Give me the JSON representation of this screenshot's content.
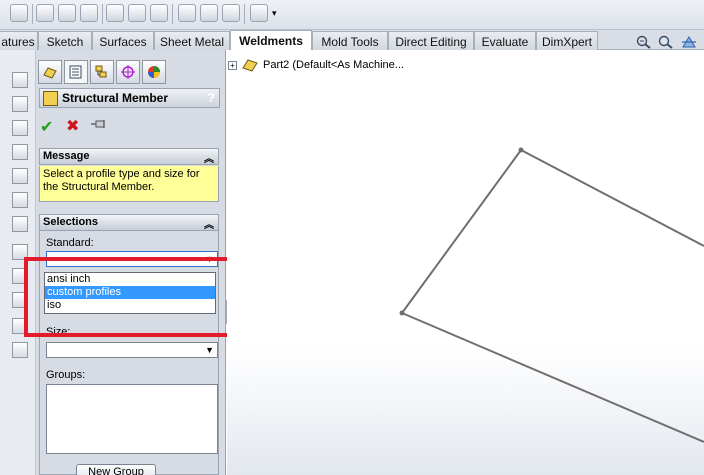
{
  "command_tabs": [
    {
      "label": "atures",
      "active": false
    },
    {
      "label": "Sketch",
      "active": false
    },
    {
      "label": "Surfaces",
      "active": false
    },
    {
      "label": "Sheet Metal",
      "active": false
    },
    {
      "label": "Weldments",
      "active": true
    },
    {
      "label": "Mold Tools",
      "active": false
    },
    {
      "label": "Direct Editing",
      "active": false
    },
    {
      "label": "Evaluate",
      "active": false
    },
    {
      "label": "DimXpert",
      "active": false
    }
  ],
  "toolbar_icons": [
    "boolean-icon",
    "trim-icon",
    "extend-icon",
    "wall-icon",
    "copy-icon",
    "cut-icon",
    "paste-icon",
    "mirror-icon",
    "gear-icon",
    "linear-pattern-icon",
    "sparkle-icon",
    "dropdown-arrow-icon"
  ],
  "view_icons": [
    "zoom-to-fit-icon",
    "zoom-area-icon",
    "section-view-icon"
  ],
  "property_manager": {
    "tab_icons": [
      "feature-manager-icon",
      "property-manager-icon",
      "configuration-manager-icon",
      "dimxpert-manager-icon",
      "display-manager-icon"
    ],
    "title": "Structural Member",
    "help": "?",
    "message_header": "Message",
    "message_text": "Select a profile type and size for the Structural Member.",
    "selections_header": "Selections",
    "standard_label": "Standard:",
    "standard_value": "",
    "standard_options": [
      "ansi inch",
      "custom profiles",
      "iso"
    ],
    "selected_option": "custom profiles",
    "size_label": "Size:",
    "size_value": "",
    "groups_label": "Groups:",
    "new_group_label": "New Group"
  },
  "feature_tree": {
    "root_label": "Part2  (Default<As Machine..."
  },
  "accent": {
    "highlight_red": "#e31b2a",
    "selection_blue": "#3399ff",
    "message_yellow": "#ffff99"
  }
}
